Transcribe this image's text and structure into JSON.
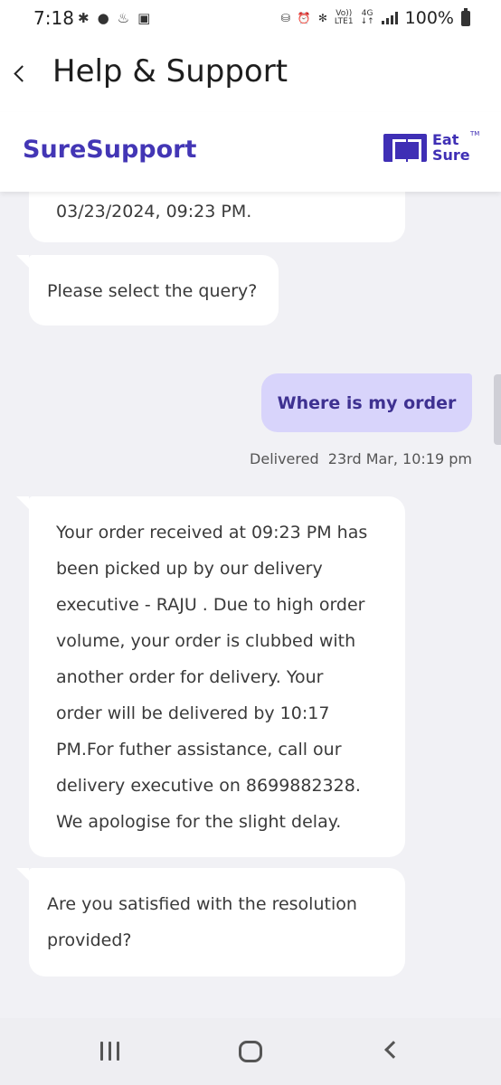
{
  "status_bar": {
    "time": "7:18",
    "network_label_top": "Vo))",
    "network_label_bottom": "LTE1",
    "data_label_top": "4G",
    "data_label_bottom": "↓↑",
    "battery": "100%"
  },
  "app_bar": {
    "title": "Help & Support"
  },
  "brand": {
    "name": "SureSupport",
    "logo_text_line1": "Eat",
    "logo_text_line2": "Sure",
    "logo_tm": "TM",
    "accent_color": "#4336b5"
  },
  "chat": {
    "messages": [
      {
        "sender": "bot",
        "text": "03/23/2024, 09:23 PM."
      },
      {
        "sender": "bot",
        "text": "Please select the query?"
      },
      {
        "sender": "user",
        "text": "Where is my order"
      },
      {
        "sender": "bot",
        "lines": [
          "Your order received at 09:23 PM has",
          "been picked up by our delivery",
          "executive - RAJU . Due to high order",
          "volume, your order is clubbed with",
          "another order for delivery. Your",
          "order will be delivered by 10:17",
          "PM.For futher assistance, call our",
          "delivery executive on 8699882328.",
          "We apologise for the slight delay."
        ]
      },
      {
        "sender": "bot",
        "lines": [
          "Are you satisfied with the resolution",
          "provided?"
        ]
      }
    ],
    "delivery_status": "Delivered",
    "delivery_time": "23rd Mar, 10:19 pm"
  }
}
